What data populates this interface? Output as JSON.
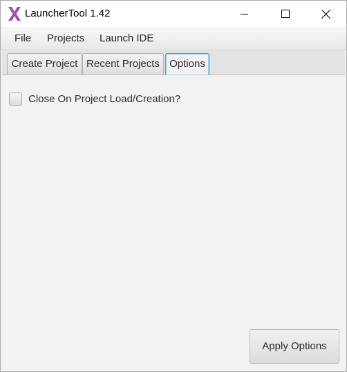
{
  "window": {
    "title": "LauncherTool 1.42",
    "icon": "app-x-icon",
    "accent_color": "#a24bb5"
  },
  "menu": {
    "items": [
      "File",
      "Projects",
      "Launch IDE"
    ]
  },
  "tabs": [
    {
      "label": "Create Project",
      "selected": false
    },
    {
      "label": "Recent Projects",
      "selected": false
    },
    {
      "label": "Options",
      "selected": true
    }
  ],
  "options": {
    "close_on_load_label": "Close On Project Load/Creation?",
    "close_on_load_checked": false,
    "apply_button_label": "Apply Options"
  },
  "colors": {
    "selected_tab_border": "#39a0d8",
    "background": "#f2f2f2"
  }
}
